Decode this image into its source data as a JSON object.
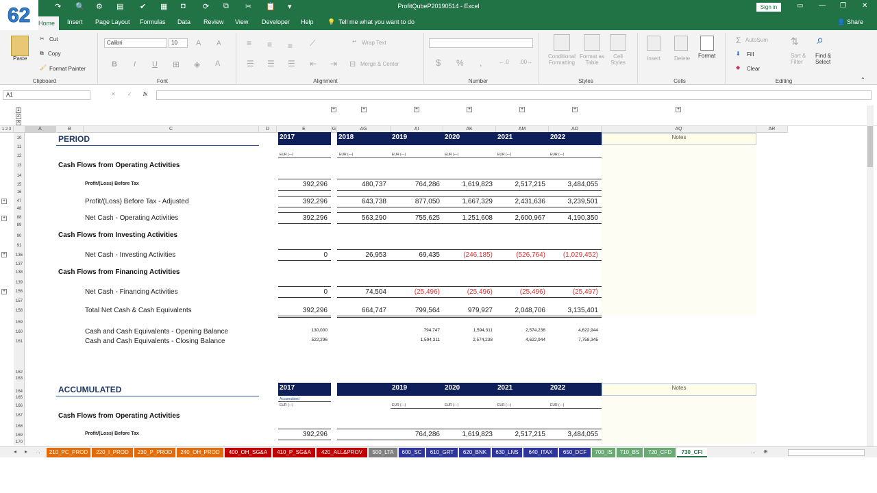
{
  "badge": "62",
  "window": {
    "title": "ProfitQubeP20190514 - Excel",
    "signin": "Sign in",
    "share": "Share"
  },
  "tabs": [
    "Home",
    "Insert",
    "Page Layout",
    "Formulas",
    "Data",
    "Review",
    "View",
    "Developer",
    "Help"
  ],
  "tell_me": "Tell me what you want to do",
  "ribbon": {
    "clipboard": {
      "paste": "Paste",
      "cut": "Cut",
      "copy": "Copy",
      "format_painter": "Format Painter",
      "label": "Clipboard"
    },
    "font": {
      "name": "Calibri",
      "size": "10",
      "label": "Font",
      "bold": "B",
      "italic": "I",
      "underline": "U",
      "font_color": "A",
      "grow": "A",
      "shrink": "A"
    },
    "alignment": {
      "wrap": "Wrap Text",
      "merge": "Merge & Center",
      "label": "Alignment"
    },
    "number": {
      "label": "Number",
      "currency": "$",
      "percent": "%",
      "comma": ","
    },
    "styles": {
      "conditional": "Conditional Formatting",
      "format_as": "Format as Table",
      "cell_styles": "Cell Styles",
      "label": "Styles"
    },
    "cells": {
      "insert": "Insert",
      "delete": "Delete",
      "format": "Format",
      "label": "Cells"
    },
    "editing": {
      "autosum": "AutoSum",
      "fill": "Fill",
      "clear": "Clear",
      "sort": "Sort & Filter",
      "find": "Find & Select",
      "label": "Editing"
    }
  },
  "formula_bar": {
    "name_box": "A1",
    "fx": "fx",
    "cancel": "✕",
    "enter": "✓"
  },
  "outline_levels": [
    "1",
    "2",
    "3"
  ],
  "column_headers": [
    "A",
    "B",
    "C",
    "D",
    "E",
    "G",
    "AG",
    "AI",
    "AK",
    "AM",
    "AO",
    "AQ",
    "AR"
  ],
  "row_headers": [
    "10",
    "11",
    "12",
    "13",
    "14",
    "15",
    "16",
    "47",
    "48",
    "88",
    "89",
    "90",
    "91",
    "136",
    "137",
    "138",
    "139",
    "156",
    "157",
    "158",
    "159",
    "160",
    "161",
    "162",
    "163",
    "164",
    "165",
    "166",
    "167",
    "168",
    "169",
    "170"
  ],
  "sheet": {
    "period_title": "PERIOD",
    "accumulated_title": "ACCUMULATED",
    "notes": "Notes",
    "year_e": "2017",
    "years": [
      "2018",
      "2019",
      "2020",
      "2021",
      "2022"
    ],
    "years_acc": [
      "2019",
      "2020",
      "2021",
      "2022"
    ],
    "unit": "EUR (---)",
    "accumulated_note": "Accumulated",
    "sec_operating": "Cash Flows from Operating Activities",
    "sec_investing": "Cash Flows from Investing Activities",
    "sec_financing": "Cash Flows from Financing Activities",
    "rows": [
      {
        "label": "Profit/(Loss) Before Tax",
        "e": "392,296",
        "v": [
          "480,737",
          "764,286",
          "1,619,823",
          "2,517,215",
          "3,484,055"
        ]
      },
      {
        "label": "Profit/(Loss) Before Tax - Adjusted",
        "e": "392,296",
        "v": [
          "643,738",
          "877,050",
          "1,667,329",
          "2,431,636",
          "3,239,501"
        ]
      },
      {
        "label": "Net Cash - Operating Activities",
        "e": "392,296",
        "v": [
          "563,290",
          "755,625",
          "1,251,608",
          "2,600,967",
          "4,190,350"
        ]
      },
      {
        "label": "Net Cash - Investing Activities",
        "e": "0",
        "v": [
          "26,953",
          "69,435",
          "(246,185)",
          "(526,764)",
          "(1,029,452)"
        ]
      },
      {
        "label": "Net Cash - Financing Activities",
        "e": "0",
        "v": [
          "74,504",
          "(25,496)",
          "(25,496)",
          "(25,496)",
          "(25,497)"
        ]
      },
      {
        "label": "Total Net Cash & Cash Equivalents",
        "e": "392,296",
        "v": [
          "664,747",
          "799,564",
          "979,927",
          "2,048,706",
          "3,135,401"
        ]
      },
      {
        "label": "Cash and Cash Equivalents - Opening Balance",
        "e": "130,000",
        "v": [
          "",
          "794,747",
          "1,594,311",
          "2,574,238",
          "4,622,944"
        ]
      },
      {
        "label": "Cash and Cash Equivalents - Closing Balance",
        "e": "522,296",
        "v": [
          "",
          "1,594,311",
          "2,574,238",
          "4,622,944",
          "7,758,345"
        ]
      }
    ],
    "acc_row": {
      "label": "Profit/(Loss) Before Tax",
      "e": "392,296",
      "v": [
        "764,286",
        "1,619,823",
        "2,517,215",
        "3,484,055"
      ]
    }
  },
  "sheet_tabs": [
    {
      "name": "210_PC_PROD",
      "color": "#e26b0a"
    },
    {
      "name": "220_I_PROD",
      "color": "#e26b0a"
    },
    {
      "name": "230_P_PROD",
      "color": "#e26b0a"
    },
    {
      "name": "240_OH_PROD",
      "color": "#e26b0a"
    },
    {
      "name": "400_OH_SG&A",
      "color": "#c00000"
    },
    {
      "name": "410_P_SG&A",
      "color": "#c00000"
    },
    {
      "name": "420_ALL&PROV",
      "color": "#c00000"
    },
    {
      "name": "500_LTA",
      "color": "#808080"
    },
    {
      "name": "600_SC",
      "color": "#2f3699"
    },
    {
      "name": "610_GRT",
      "color": "#2f3699"
    },
    {
      "name": "620_BNK",
      "color": "#2f3699"
    },
    {
      "name": "630_LNS",
      "color": "#2f3699"
    },
    {
      "name": "640_ITAX",
      "color": "#2f3699"
    },
    {
      "name": "650_DCF",
      "color": "#2f3699"
    },
    {
      "name": "700_IS",
      "color": "#6aa974"
    },
    {
      "name": "710_BS",
      "color": "#6aa974"
    },
    {
      "name": "720_CFD",
      "color": "#6aa974"
    },
    {
      "name": "730_CFI",
      "color": "#6aa974",
      "active": true
    }
  ],
  "sheet_nav_more": "...",
  "colors": {
    "excel_green": "#217346",
    "navy": "#0f1f5a",
    "negative": "#e03030"
  }
}
